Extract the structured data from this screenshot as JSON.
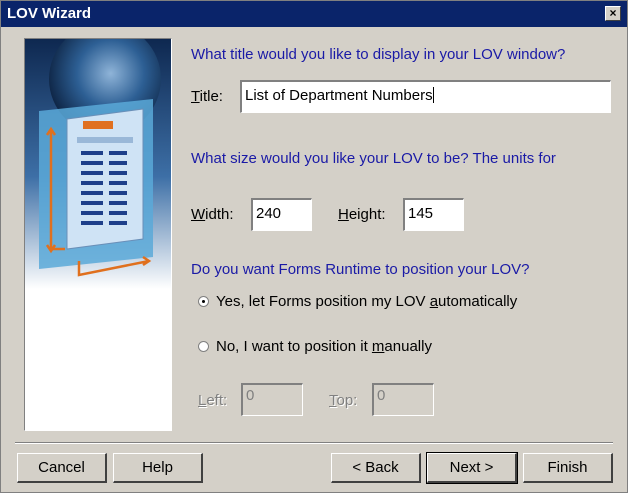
{
  "window": {
    "title": "LOV Wizard",
    "close_glyph": "×"
  },
  "questions": {
    "title_q": "What title would you like to display in your LOV window?",
    "size_q": "What size would you like your LOV to be? The units for",
    "position_q": "Do you want Forms Runtime to position your LOV?"
  },
  "title_field": {
    "label_pre": "",
    "label_u": "T",
    "label_post": "itle:",
    "value": "List of Department Numbers"
  },
  "width_field": {
    "label_u": "W",
    "label_post": "idth:",
    "value": "240"
  },
  "height_field": {
    "label_u": "H",
    "label_post": "eight:",
    "value": "145"
  },
  "radio_auto": {
    "label_pre": "Yes, let Forms position my LOV ",
    "label_u": "a",
    "label_post": "utomatically",
    "selected": true
  },
  "radio_manual": {
    "label_pre": "No, I want to position it ",
    "label_u": "m",
    "label_post": "anually",
    "selected": false
  },
  "left_field": {
    "label_u": "L",
    "label_post": "eft:",
    "value": "0"
  },
  "top_field": {
    "label_u": "T",
    "label_post": "op:",
    "value": "0"
  },
  "buttons": {
    "cancel": "Cancel",
    "help": "Help",
    "back": "< Back",
    "next": "Next >",
    "finish": "Finish"
  },
  "colors": {
    "titlebar": "#0a246a",
    "question_text": "#1a1aa6",
    "dialog_bg": "#d4d0c8"
  }
}
